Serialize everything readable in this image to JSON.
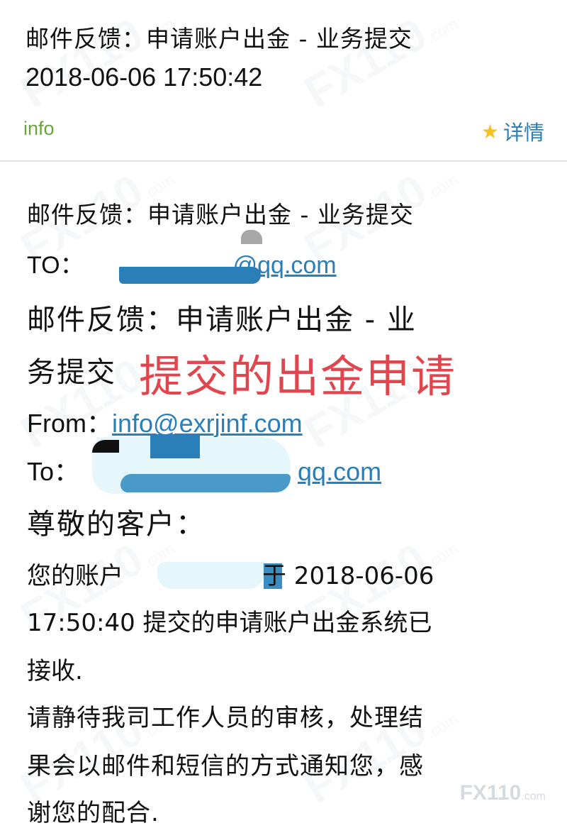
{
  "header": {
    "subject": "邮件反馈：申请账户出金 - 业务提交",
    "datetime": "2018-06-06 17:50:42",
    "sender": "info",
    "details_label": "详情",
    "star_icon": "star-icon"
  },
  "body": {
    "subject_line": "邮件反馈：申请账户出金 - 业务提交",
    "to_label": "TO：",
    "to_address_visible": "@qq.com",
    "subject_large_part1": "邮件反馈：申请账户出金 - 业",
    "subject_large_part2": "务提交",
    "annotation": "提交的出金申请",
    "from_label": "From：",
    "from_address": "info@exrjinf.com",
    "to2_label": "To：",
    "to2_address_visible": "qq.com",
    "greeting": "尊敬的客户：",
    "account_prefix": "您的账户",
    "account_suffix": "于 2018-06-06",
    "line2": "17:50:40 提交的申请账户出金系统已",
    "line3": "接收.",
    "line4": "请静待我司工作人员的审核，处理结",
    "line5": "果会以邮件和短信的方式通知您，感",
    "line6": "谢您的配合."
  },
  "watermark": {
    "text": "FX110",
    "suffix": ".com"
  },
  "colors": {
    "sender": "#6aa53a",
    "link": "#2a7fb8",
    "star": "#f4c220",
    "annotation": "#e0464e"
  }
}
